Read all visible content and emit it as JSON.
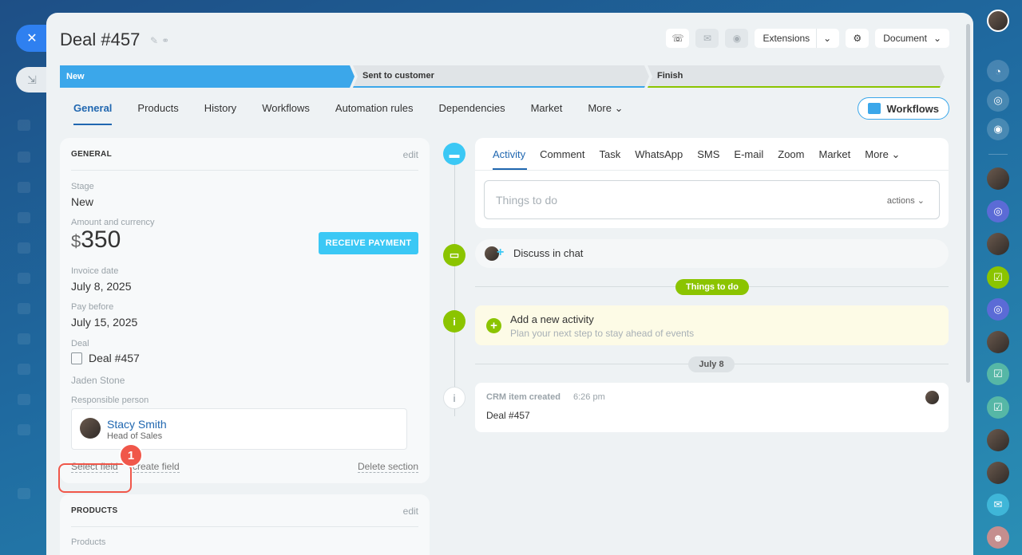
{
  "window": {
    "close_glyph": "✕",
    "minimize_glyph": "⇲"
  },
  "header": {
    "title": "Deal #457",
    "extensions_label": "Extensions",
    "document_label": "Document"
  },
  "stages": [
    {
      "label": "New",
      "color": "#3ba7ea"
    },
    {
      "label": "Sent to customer",
      "color": "#3ba7ea"
    },
    {
      "label": "Finish",
      "color": "#8bc400"
    }
  ],
  "tabs": [
    "General",
    "Products",
    "History",
    "Workflows",
    "Automation rules",
    "Dependencies",
    "Market",
    "More"
  ],
  "workflows_button": "Workflows",
  "general": {
    "heading": "GENERAL",
    "edit": "edit",
    "stage_label": "Stage",
    "stage_value": "New",
    "amount_label": "Amount and currency",
    "currency": "$",
    "amount": "350",
    "receive_payment": "RECEIVE PAYMENT",
    "invoice_label": "Invoice date",
    "invoice_value": "July 8, 2025",
    "pay_label": "Pay before",
    "pay_value": "July 15, 2025",
    "deal_label": "Deal",
    "deal_value": "Deal #457",
    "deal_contact": "Jaden Stone",
    "responsible_label": "Responsible person",
    "responsible_name": "Stacy Smith",
    "responsible_position": "Head of Sales",
    "select_field": "Select field",
    "create_field": "create field",
    "delete_section": "Delete section",
    "step_badge": "1"
  },
  "products": {
    "heading": "PRODUCTS",
    "edit": "edit",
    "label": "Products"
  },
  "activity": {
    "tabs": [
      "Activity",
      "Comment",
      "Task",
      "WhatsApp",
      "SMS",
      "E-mail",
      "Zoom",
      "Market",
      "More"
    ],
    "placeholder": "Things to do",
    "actions": "actions"
  },
  "timeline": {
    "discuss": "Discuss in chat",
    "todo_pill": "Things to do",
    "add_title": "Add a new activity",
    "add_sub": "Plan your next step to stay ahead of events",
    "date_pill": "July 8",
    "crm_title": "CRM item created",
    "crm_time": "6:26 pm",
    "crm_deal": "Deal #457"
  },
  "colors": {
    "accent": "#2067b0",
    "highlight": "#f0574a",
    "success": "#8bc400",
    "info": "#3bc8f5"
  }
}
